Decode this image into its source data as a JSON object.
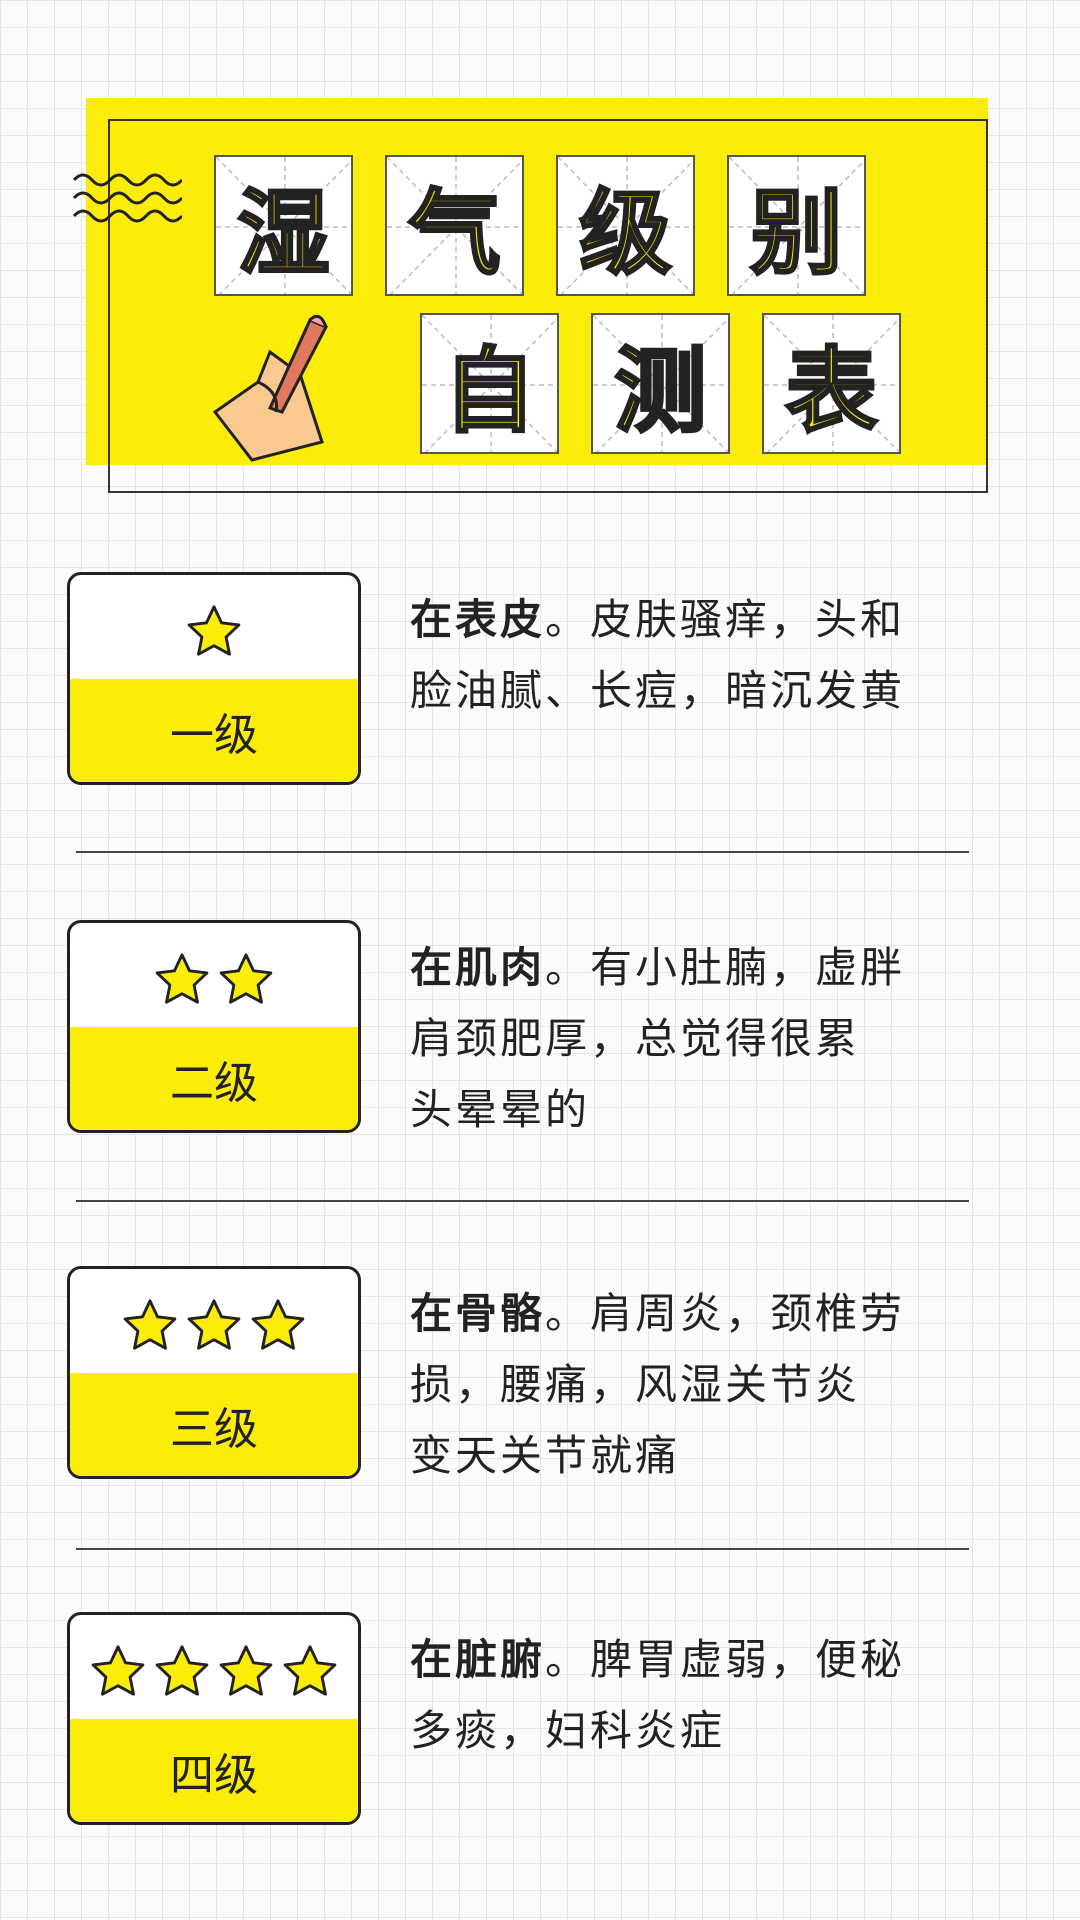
{
  "title": {
    "chars_row1": [
      "湿",
      "气",
      "级",
      "别"
    ],
    "chars_row2": [
      "自",
      "测",
      "表"
    ]
  },
  "levels": [
    {
      "stars": 1,
      "label": "一级",
      "heading": "在表皮",
      "lines": [
        "。皮肤骚痒，头和",
        "脸油腻、长痘，暗沉发黄"
      ]
    },
    {
      "stars": 2,
      "label": "二级",
      "heading": "在肌肉",
      "lines": [
        "。有小肚腩，虚胖",
        "肩颈肥厚，总觉得很累",
        "头晕晕的"
      ]
    },
    {
      "stars": 3,
      "label": "三级",
      "heading": "在骨骼",
      "lines": [
        "。肩周炎，颈椎劳",
        "损，腰痛，风湿关节炎",
        "变天关节就痛"
      ]
    },
    {
      "stars": 4,
      "label": "四级",
      "heading": "在脏腑",
      "lines": [
        "。脾胃虚弱，便秘",
        "多痰，妇科炎症"
      ]
    }
  ],
  "colors": {
    "accent": "#fcec0a",
    "ink": "#222222",
    "skin": "#f9c98f"
  }
}
